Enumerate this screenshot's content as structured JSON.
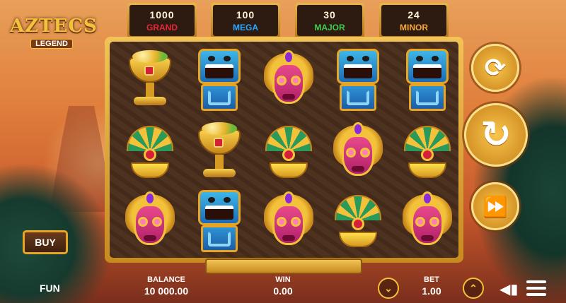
{
  "logo": {
    "title": "AZTECS",
    "subtitle": "LEGEND"
  },
  "jackpots": [
    {
      "value": "1000",
      "label": "GRAND",
      "color": "#e8283a"
    },
    {
      "value": "100",
      "label": "MEGA",
      "color": "#2aa8ff"
    },
    {
      "value": "30",
      "label": "MAJOR",
      "color": "#3ed04a"
    },
    {
      "value": "24",
      "label": "MINOR",
      "color": "#f4a83a"
    }
  ],
  "reels": [
    [
      "chalice",
      "blue-mask",
      "pink-mask",
      "blue-mask",
      "blue-mask"
    ],
    [
      "fan",
      "chalice",
      "fan",
      "pink-mask",
      "fan"
    ],
    [
      "pink-mask",
      "blue-mask",
      "pink-mask",
      "fan",
      "pink-mask"
    ]
  ],
  "controls": {
    "autoplay_icon": "refresh-icon",
    "spin_icon": "spin-arrow-icon",
    "turbo_icon": "fast-forward-icon",
    "buy_label": "BUY"
  },
  "bottom": {
    "mode": "FUN",
    "balance_label": "BALANCE",
    "balance_value": "10 000.00",
    "win_label": "WIN",
    "win_value": "0.00",
    "bet_label": "BET",
    "bet_value": "1.00"
  },
  "colors": {
    "frame_gold": "#f2c356",
    "panel_bg": "#4a2e1c"
  }
}
